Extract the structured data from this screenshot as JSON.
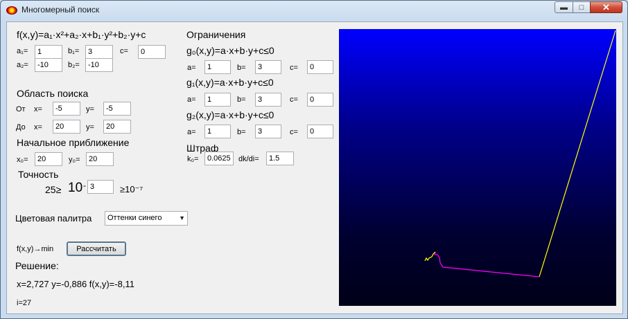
{
  "window": {
    "title": "Многомерный поиск"
  },
  "function_label": "f(x,y)=a₁·x²+a₂·x+b₁·y²+b₂·y+c",
  "coeffs": {
    "a1_label": "a₁=",
    "a1": "1",
    "b1_label": "b₁=",
    "b1": "3",
    "c_label": "c=",
    "c": "0",
    "a2_label": "a₂=",
    "a2": "-10",
    "b2_label": "b₂=",
    "b2": "-10"
  },
  "search_area": {
    "title": "Область поиска",
    "from_label": "От",
    "to_label": "До",
    "x_label": "x=",
    "y_label": "y=",
    "from_x": "-5",
    "from_y": "-5",
    "to_x": "20",
    "to_y": "20"
  },
  "initial": {
    "title": "Начальное приближение",
    "x0_label": "x₀=",
    "x0": "20",
    "y0_label": "y₀=",
    "y0": "20"
  },
  "precision": {
    "title": "Точность",
    "prefix": "25≥",
    "base": "10",
    "minus": "-",
    "exponent": "3",
    "suffix": "≥10⁻⁷"
  },
  "palette": {
    "label": "Цветовая палитра",
    "selected": "Оттенки синего"
  },
  "compute": {
    "target": "f(x,y)→min",
    "button": "Рассчитать"
  },
  "solution": {
    "title": "Решение:",
    "result": "x=2,727 y=-0,886 f(x,y)=-8,11",
    "iterations": "i=27"
  },
  "constraints": {
    "title": "Ограничения",
    "a_label": "a=",
    "b_label": "b=",
    "c_label": "c=",
    "items": [
      {
        "label": "g₀(x,y)=a·x+b·y+c≤0",
        "a": "1",
        "b": "3",
        "c": "0"
      },
      {
        "label": "g₁(x,y)=a·x+b·y+c≤0",
        "a": "1",
        "b": "3",
        "c": "0"
      },
      {
        "label": "g₂(x,y)=a·x+b·y+c≤0",
        "a": "1",
        "b": "3",
        "c": "0"
      }
    ]
  },
  "penalty": {
    "title": "Штраф",
    "k0_label": "k₀=",
    "k0": "0.0625",
    "ratio_label": "dk/di=",
    "ratio": "1.5"
  },
  "plot": {
    "background_top": "#0000ff",
    "background_bottom": "#000018",
    "path_colors": [
      "#ffff00",
      "#ff00ff"
    ]
  }
}
